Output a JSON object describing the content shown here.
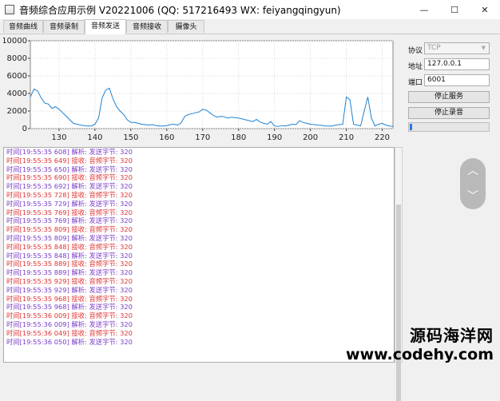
{
  "window": {
    "title": "音频综合应用示例 V20221006 (QQ: 517216493 WX: feiyangqingyun)",
    "min_glyph": "—",
    "max_glyph": "☐",
    "close_glyph": "✕"
  },
  "tabs": [
    {
      "label": "音频曲线",
      "active": false
    },
    {
      "label": "音频录制",
      "active": false
    },
    {
      "label": "音频发送",
      "active": true
    },
    {
      "label": "音频接收",
      "active": false
    },
    {
      "label": "摄像头",
      "active": false
    }
  ],
  "chart_data": {
    "type": "line",
    "title": "",
    "xlabel": "",
    "ylabel": "",
    "xlim": [
      122,
      223
    ],
    "ylim": [
      0,
      10000
    ],
    "xticks": [
      130,
      140,
      150,
      160,
      170,
      180,
      190,
      200,
      210,
      220
    ],
    "yticks": [
      0,
      2000,
      4000,
      6000,
      8000,
      10000
    ],
    "grid": true,
    "color": "#1e82d2",
    "series": [
      {
        "x": [
          122,
          123,
          124,
          125,
          126,
          127,
          128,
          129,
          130,
          131,
          132,
          133,
          134,
          135,
          136,
          137,
          138,
          139,
          140,
          141,
          142,
          143,
          144,
          145,
          146,
          147,
          148,
          149,
          150,
          151,
          152,
          153,
          154,
          155,
          156,
          157,
          158,
          159,
          160,
          161,
          162,
          163,
          164,
          165,
          166,
          167,
          168,
          169,
          170,
          171,
          172,
          173,
          174,
          175,
          176,
          177,
          178,
          179,
          180,
          181,
          182,
          183,
          184,
          185,
          186,
          187,
          188,
          189,
          190,
          191,
          192,
          193,
          194,
          195,
          196,
          197,
          198,
          199,
          200,
          201,
          202,
          203,
          204,
          205,
          206,
          207,
          208,
          209,
          210,
          211,
          212,
          213,
          214,
          215,
          216,
          217,
          218,
          219,
          220,
          221,
          222,
          223
        ],
        "y": [
          3600,
          4500,
          4300,
          3500,
          2900,
          2800,
          2300,
          2500,
          2200,
          1800,
          1400,
          1000,
          600,
          500,
          400,
          350,
          300,
          300,
          500,
          1200,
          3500,
          4400,
          4600,
          3400,
          2500,
          2000,
          1600,
          1000,
          700,
          700,
          600,
          500,
          450,
          400,
          450,
          350,
          300,
          300,
          350,
          450,
          500,
          400,
          650,
          1400,
          1600,
          1700,
          1800,
          1900,
          2200,
          2100,
          1800,
          1500,
          1300,
          1400,
          1350,
          1200,
          1300,
          1250,
          1200,
          1100,
          1000,
          900,
          800,
          1050,
          750,
          600,
          500,
          800,
          300,
          250,
          350,
          300,
          400,
          500,
          450,
          900,
          700,
          600,
          500,
          450,
          400,
          380,
          300,
          300,
          280,
          400,
          450,
          500,
          3600,
          3300,
          500,
          400,
          300,
          2000,
          3600,
          1200,
          300,
          500,
          600,
          400,
          300,
          250
        ]
      }
    ]
  },
  "log": [
    {
      "ts": "时间[19:55:35 608]",
      "kind": "解析: 发送字节: 320",
      "color": "#7a3cc8"
    },
    {
      "ts": "时间[19:55:35 649]",
      "kind": "接收: 音频字节: 320",
      "color": "#e03232"
    },
    {
      "ts": "时间[19:55:35 650]",
      "kind": "解析: 发送字节: 320",
      "color": "#7a3cc8"
    },
    {
      "ts": "时间[19:55:35 690]",
      "kind": "接收: 音频字节: 320",
      "color": "#e03232"
    },
    {
      "ts": "时间[19:55:35 692]",
      "kind": "解析: 发送字节: 320",
      "color": "#7a3cc8"
    },
    {
      "ts": "时间[19:55:35 728]",
      "kind": "接收: 音频字节: 320",
      "color": "#e03232"
    },
    {
      "ts": "时间[19:55:35 729]",
      "kind": "解析: 发送字节: 320",
      "color": "#7a3cc8"
    },
    {
      "ts": "时间[19:55:35 769]",
      "kind": "接收: 音频字节: 320",
      "color": "#e03232"
    },
    {
      "ts": "时间[19:55:35 769]",
      "kind": "解析: 发送字节: 320",
      "color": "#7a3cc8"
    },
    {
      "ts": "时间[19:55:35 809]",
      "kind": "接收: 音频字节: 320",
      "color": "#e03232"
    },
    {
      "ts": "时间[19:55:35 809]",
      "kind": "解析: 发送字节: 320",
      "color": "#7a3cc8"
    },
    {
      "ts": "时间[19:55:35 848]",
      "kind": "接收: 音频字节: 320",
      "color": "#e03232"
    },
    {
      "ts": "时间[19:55:35 848]",
      "kind": "解析: 发送字节: 320",
      "color": "#7a3cc8"
    },
    {
      "ts": "时间[19:55:35 889]",
      "kind": "接收: 音频字节: 320",
      "color": "#e03232"
    },
    {
      "ts": "时间[19:55:35 889]",
      "kind": "解析: 发送字节: 320",
      "color": "#7a3cc8"
    },
    {
      "ts": "时间[19:55:35 929]",
      "kind": "接收: 音频字节: 320",
      "color": "#e03232"
    },
    {
      "ts": "时间[19:55:35 929]",
      "kind": "解析: 发送字节: 320",
      "color": "#7a3cc8"
    },
    {
      "ts": "时间[19:55:35 968]",
      "kind": "接收: 音频字节: 320",
      "color": "#e03232"
    },
    {
      "ts": "时间[19:55:35 968]",
      "kind": "解析: 发送字节: 320",
      "color": "#7a3cc8"
    },
    {
      "ts": "时间[19:55:36 009]",
      "kind": "接收: 音频字节: 320",
      "color": "#e03232"
    },
    {
      "ts": "时间[19:55:36 009]",
      "kind": "解析: 发送字节: 320",
      "color": "#7a3cc8"
    },
    {
      "ts": "时间[19:55:36 049]",
      "kind": "接收: 音频字节: 320",
      "color": "#e03232"
    },
    {
      "ts": "时间[19:55:36 050]",
      "kind": "解析: 发送字节: 320",
      "color": "#7a3cc8"
    }
  ],
  "right_panel": {
    "protocol_label": "协议",
    "protocol_value": "TCP",
    "address_label": "地址",
    "address_value": "127.0.0.1",
    "port_label": "端口",
    "port_value": "6001",
    "stop_server_label": "停止服务",
    "stop_record_label": "停止录音",
    "volume_level": 0.03,
    "accent_color": "#2b7bd6"
  },
  "float_controls": {
    "up_glyph": "︿",
    "down_glyph": "﹀"
  },
  "watermark": {
    "line1": "源码海洋网",
    "line2": "www.codehy.com"
  }
}
